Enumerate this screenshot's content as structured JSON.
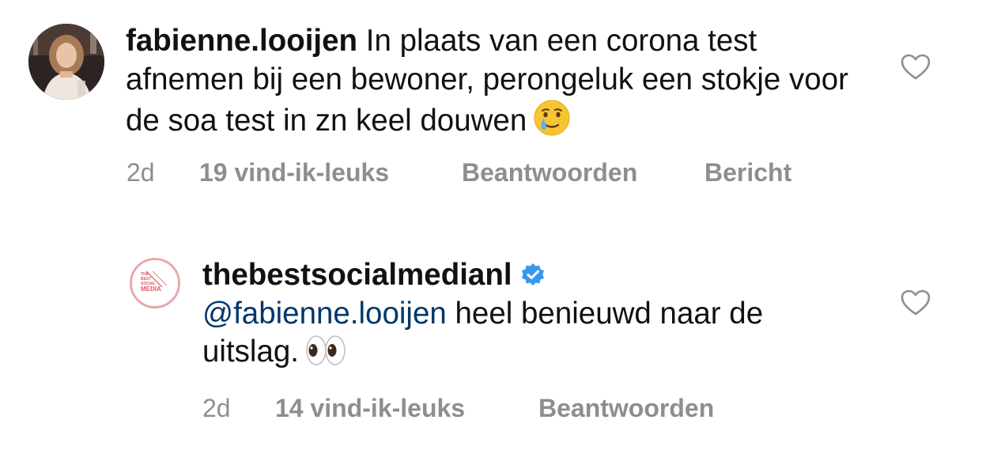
{
  "comments": [
    {
      "username": "fabienne.looijen",
      "text": "In plaats van een corona test afnemen bij een bewoner, perongeluk een stokje voor de soa test in zn keel douwen",
      "emoji": "crying-smile-emoji",
      "time": "2d",
      "likes": "19 vind-ik-leuks",
      "reply_label": "Beantwoorden",
      "message_label": "Bericht"
    },
    {
      "username": "thebestsocialmedianl",
      "verified": true,
      "mention": "@fabienne.looijen",
      "text": "heel benieuwd naar de uitslag.",
      "emoji": "eyes-emoji",
      "time": "2d",
      "likes": "14 vind-ik-leuks",
      "reply_label": "Beantwoorden"
    }
  ],
  "logo": {
    "line1": "THE",
    "line2": "BEST",
    "line3": "SOCIAL",
    "line4": "MEDIA"
  },
  "colors": {
    "meta": "#8e8e8e",
    "mention": "#00376b",
    "verified": "#3897f0",
    "logo_accent": "#e05866"
  }
}
